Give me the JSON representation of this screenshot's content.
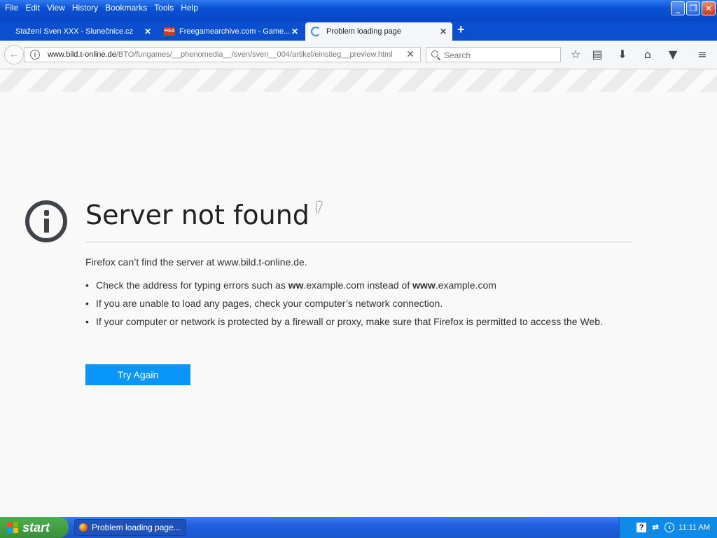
{
  "menubar": {
    "items": [
      "File",
      "Edit",
      "View",
      "History",
      "Bookmarks",
      "Tools",
      "Help"
    ]
  },
  "tabs": [
    {
      "label": "Stažení Sven XXX - Slunečnice.cz"
    },
    {
      "label": "Freegamearchive.com - Game..."
    },
    {
      "label": "Problem loading page"
    }
  ],
  "urlbar": {
    "host": "www.bild.t-online.de",
    "path": "/BTO/fungames/__phenomedia__/sven/sven__004/artikel/einstieg__preview.html"
  },
  "search": {
    "placeholder": "Search"
  },
  "error": {
    "title": "Server not found",
    "description": "Firefox can’t find the server at www.bild.t-online.de.",
    "bullet1_pre": "Check the address for typing errors such as ",
    "bullet1_b1": "ww",
    "bullet1_mid": ".example.com instead of ",
    "bullet1_b2": "www",
    "bullet1_post": ".example.com",
    "bullet2": "If you are unable to load any pages, check your computer’s network connection.",
    "bullet3": "If your computer or network is protected by a firewall or proxy, make sure that Firefox is permitted to access the Web.",
    "button": "Try Again"
  },
  "taskbar": {
    "start": "start",
    "task": "Problem loading page...",
    "clock": "11:11 AM"
  }
}
